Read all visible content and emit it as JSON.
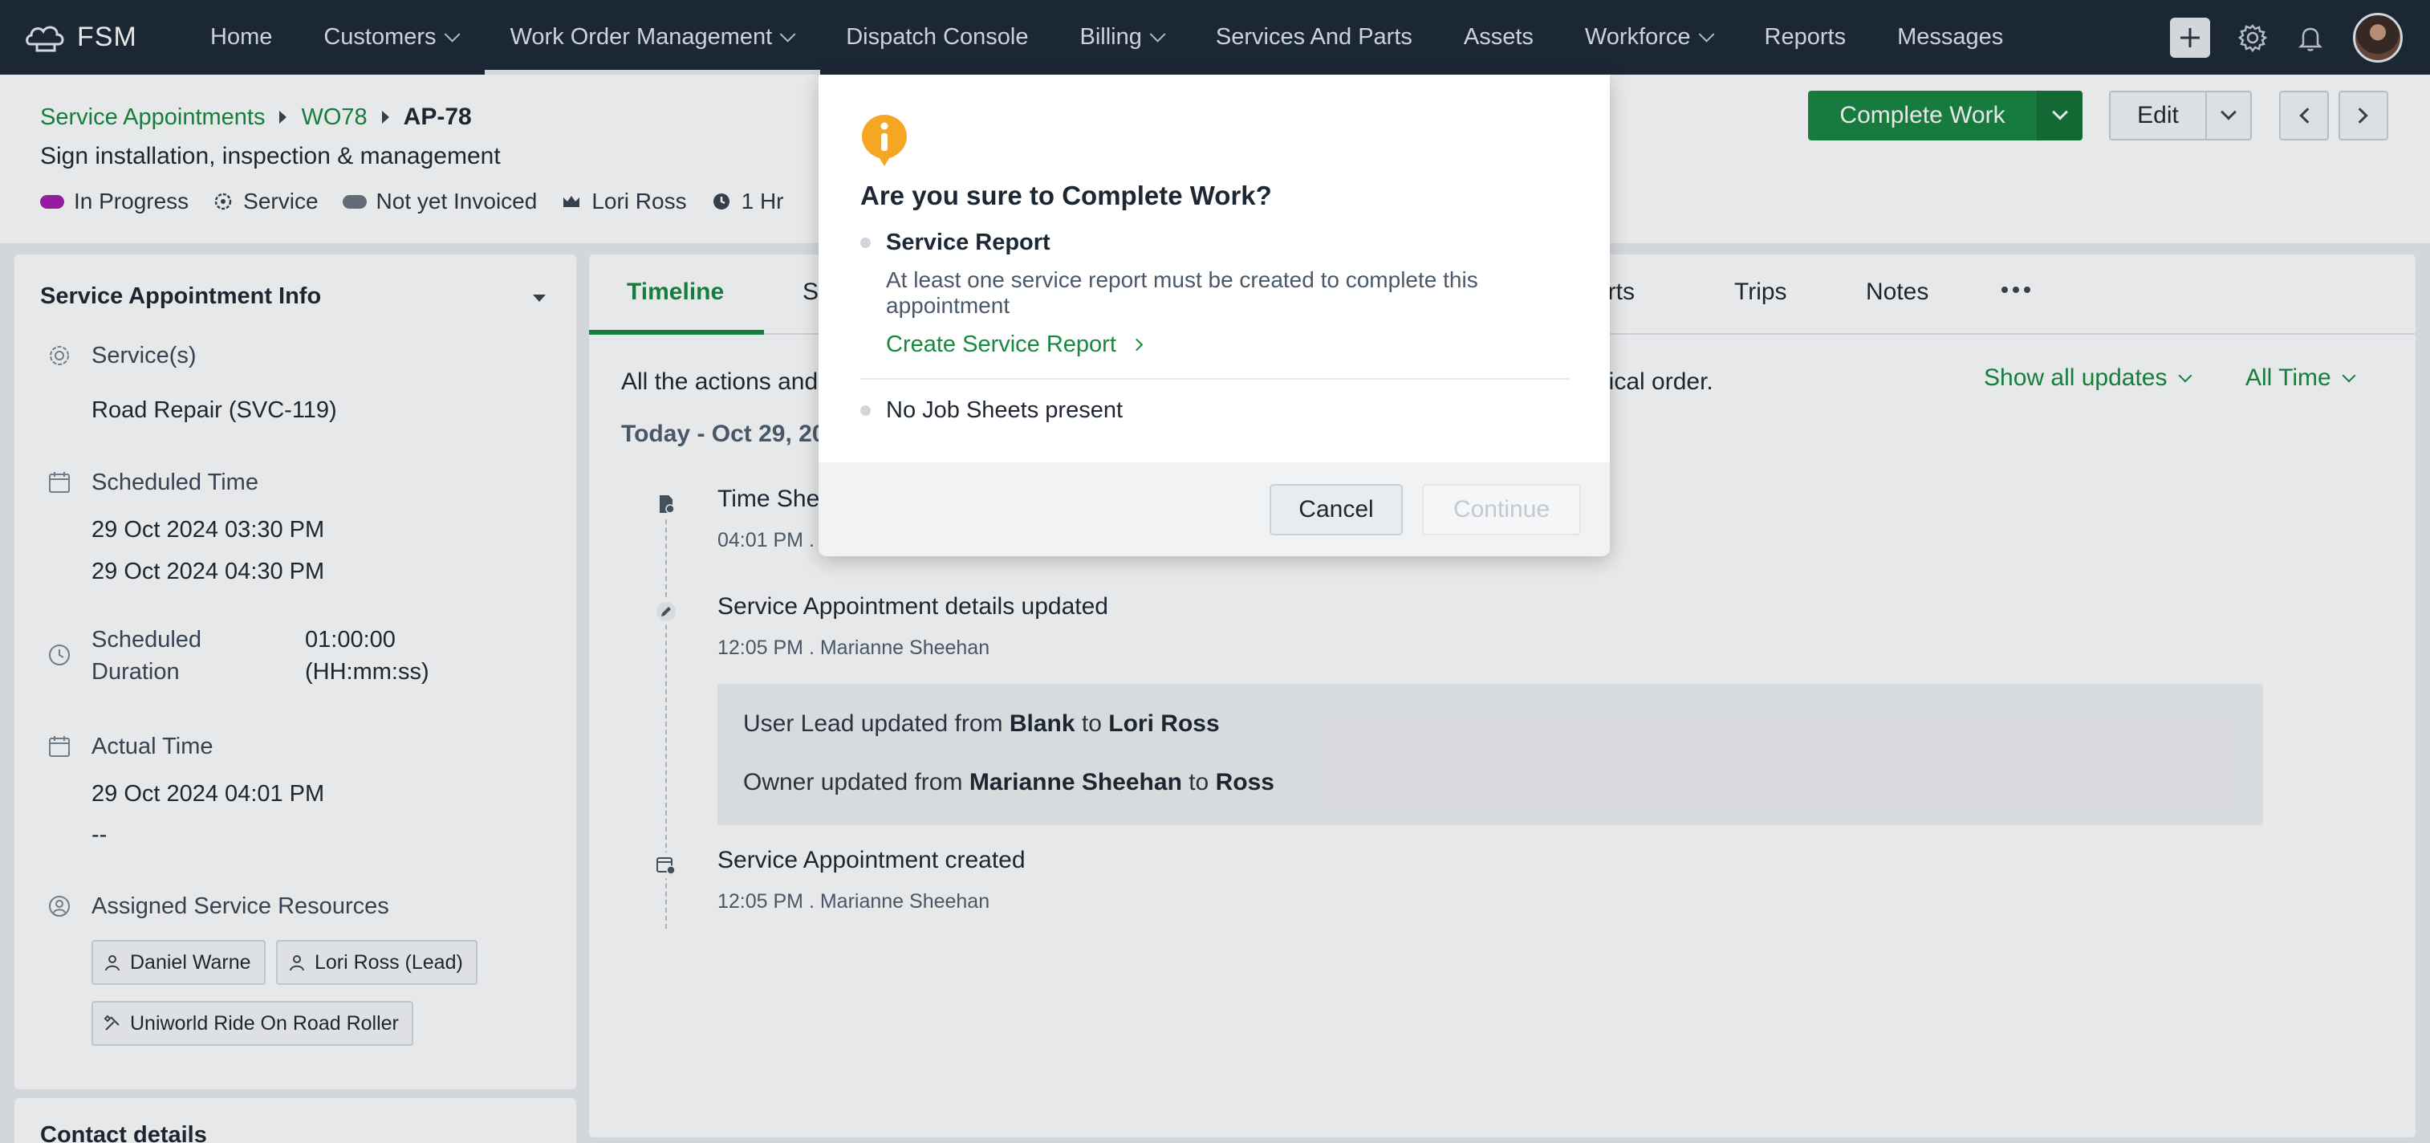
{
  "app": {
    "name": "FSM"
  },
  "nav": {
    "items": [
      {
        "label": "Home",
        "dropdown": false
      },
      {
        "label": "Customers",
        "dropdown": true
      },
      {
        "label": "Work Order Management",
        "dropdown": true,
        "active": true
      },
      {
        "label": "Dispatch Console",
        "dropdown": false
      },
      {
        "label": "Billing",
        "dropdown": true
      },
      {
        "label": "Services And Parts",
        "dropdown": false
      },
      {
        "label": "Assets",
        "dropdown": false
      },
      {
        "label": "Workforce",
        "dropdown": true
      },
      {
        "label": "Reports",
        "dropdown": false
      },
      {
        "label": "Messages",
        "dropdown": false
      }
    ]
  },
  "breadcrumb": {
    "level1": "Service Appointments",
    "level2": "WO78",
    "current": "AP-78"
  },
  "record": {
    "subtitle": "Sign installation, inspection & management",
    "status": "In Progress",
    "status_color": "#a21caf",
    "type": "Service",
    "invoice_status": "Not yet Invoiced",
    "invoice_color": "#6b7280",
    "lead": "Lori Ross",
    "duration": "1 Hr"
  },
  "actions": {
    "complete": "Complete Work",
    "edit": "Edit"
  },
  "left_panel": {
    "title": "Service Appointment Info",
    "services_label": "Service(s)",
    "services_value": "Road Repair (SVC-119)",
    "scheduled_label": "Scheduled Time",
    "scheduled_start": "29 Oct 2024 03:30 PM",
    "scheduled_end": "29 Oct 2024 04:30 PM",
    "duration_label_1": "Scheduled",
    "duration_label_2": "Duration",
    "duration_value_1": "01:00:00",
    "duration_value_2": "(HH:mm:ss)",
    "actual_label": "Actual Time",
    "actual_start": "29 Oct 2024 04:01 PM",
    "actual_end": "--",
    "resources_label": "Assigned Service Resources",
    "resources": [
      "Daniel Warne",
      "Lori Ross (Lead)",
      "Uniworld Ride On Road Roller"
    ],
    "contact_title": "Contact details"
  },
  "tabs": {
    "timeline": "Timeline",
    "partial_1": "S",
    "partial_2": "orts",
    "trips": "Trips",
    "notes": "Notes"
  },
  "timeline": {
    "intro_visible": "All the actions and",
    "intro_tail": "gical order.",
    "filter": "Show all updates",
    "range": "All Time",
    "date_heading": "Today - Oct 29, 20",
    "events": [
      {
        "title": "Time She",
        "meta": "04:01 PM ."
      },
      {
        "title": "Service Appointment details updated",
        "meta": "12:05 PM . Marianne Sheehan"
      },
      {
        "title": "Service Appointment created",
        "meta": "12:05 PM . Marianne Sheehan"
      }
    ],
    "changes": {
      "line1_prefix": "User Lead updated from ",
      "line1_from": "Blank",
      "line1_mid": " to ",
      "line1_to": "Lori Ross",
      "line2_prefix": "Owner updated from ",
      "line2_from": "Marianne Sheehan",
      "line2_mid": " to ",
      "line2_to": "Ross"
    }
  },
  "modal": {
    "icon": "info-icon",
    "icon_color": "#f5a623",
    "title": "Are you sure to Complete Work?",
    "item1_title": "Service Report",
    "item1_desc": "At least one service report must be created to complete this appointment",
    "item1_link": "Create Service Report",
    "item2_title": "No Job Sheets present",
    "cancel": "Cancel",
    "continue": "Continue"
  }
}
